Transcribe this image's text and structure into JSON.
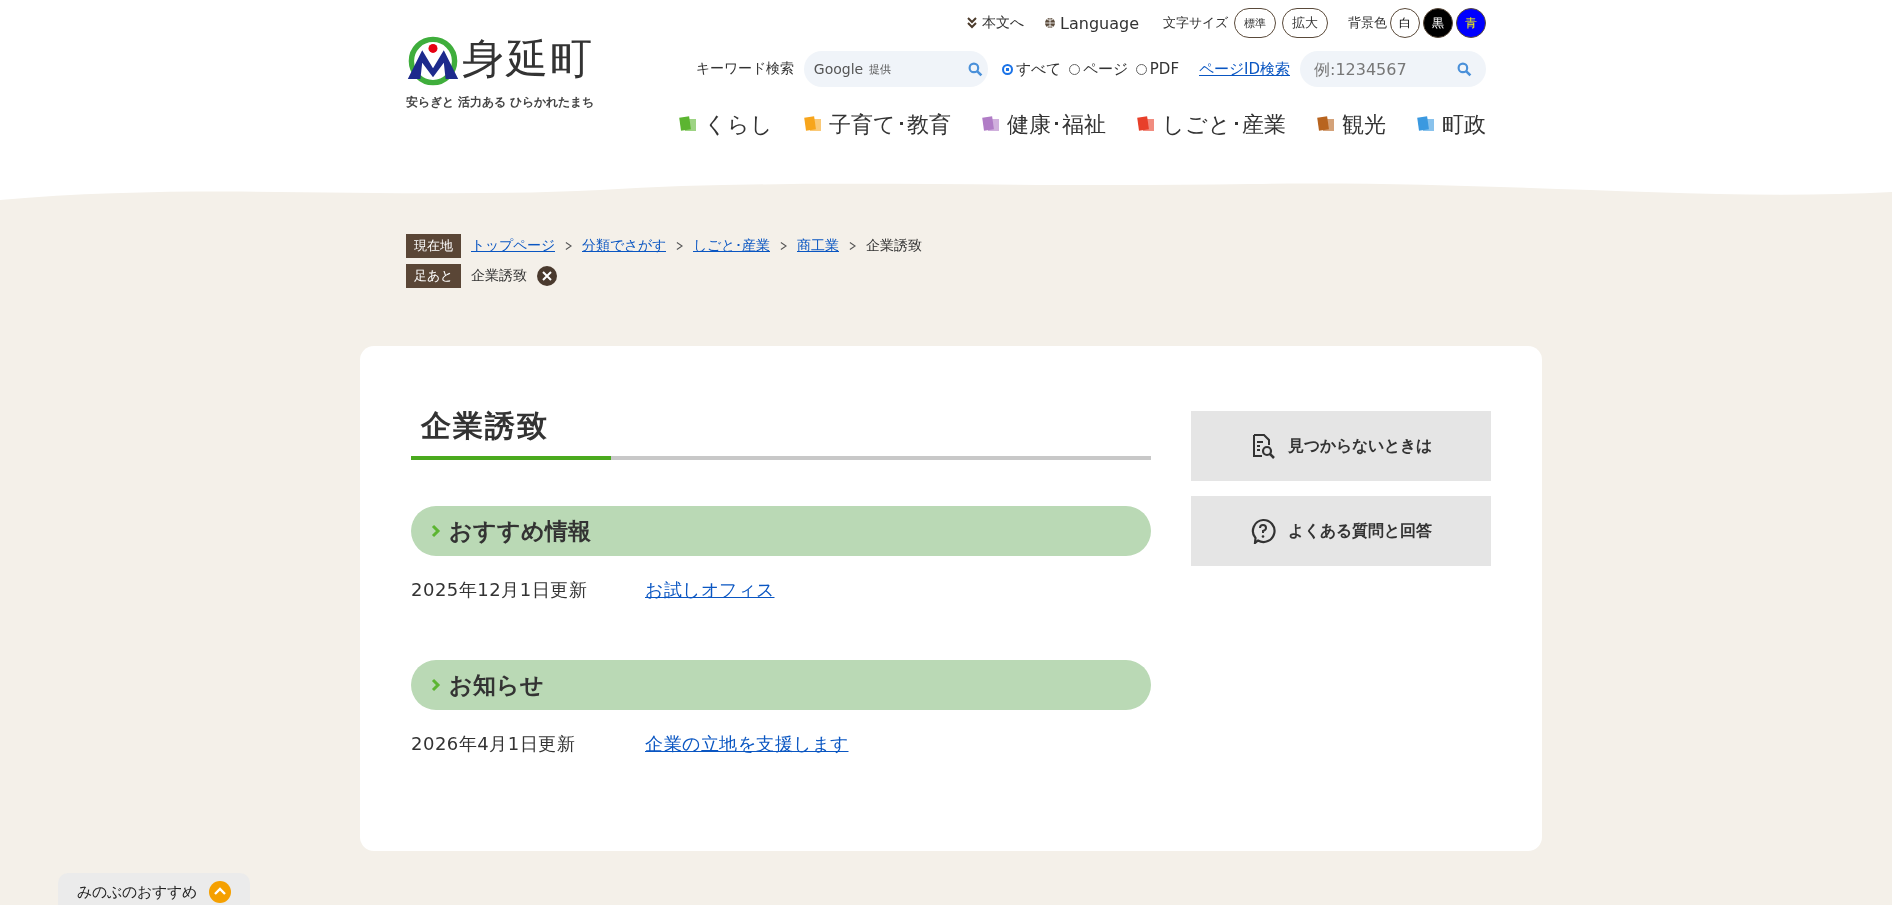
{
  "header": {
    "logo": {
      "name": "身延町",
      "tagline": "安らぎと 活力ある ひらかれたまち"
    },
    "utility": {
      "skip_link": "本文へ",
      "language": "Language",
      "font_size_label": "文字サイズ",
      "font_sizes": [
        "標準",
        "拡大"
      ],
      "bg_label": "背景色",
      "bg_colors": [
        {
          "label": "白",
          "color": "#ffffff"
        },
        {
          "label": "黒",
          "color": "#000000"
        },
        {
          "label": "青",
          "color": "#0000ff"
        }
      ]
    },
    "search": {
      "label": "キーワード検索",
      "google": "Google",
      "provided": "提供",
      "scopes": [
        {
          "label": "すべて",
          "selected": true
        },
        {
          "label": "ページ",
          "selected": false
        },
        {
          "label": "PDF",
          "selected": false
        }
      ],
      "page_id_link": "ページID検索",
      "page_id_placeholder": "例:1234567"
    },
    "nav": [
      {
        "label": "くらし",
        "color": "#5cb531"
      },
      {
        "label": "子育て･教育",
        "color": "#f7a51c"
      },
      {
        "label": "健康･福祉",
        "color": "#b07cc6"
      },
      {
        "label": "しごと･産業",
        "color": "#e8402a"
      },
      {
        "label": "観光",
        "color": "#b8641f"
      },
      {
        "label": "町政",
        "color": "#3b99e0"
      }
    ]
  },
  "breadcrumb": {
    "label": "現在地",
    "links": [
      "トップページ",
      "分類でさがす",
      "しごと･産業",
      "商工業"
    ],
    "current": "企業誘致"
  },
  "footprints": {
    "label": "足あと",
    "items": [
      "企業誘致"
    ]
  },
  "main": {
    "title": "企業誘致",
    "sections": [
      {
        "heading": "おすすめ情報",
        "items": [
          {
            "date": "2025年12月1日更新",
            "link": "お試しオフィス"
          }
        ]
      },
      {
        "heading": "お知らせ",
        "items": [
          {
            "date": "2026年4月1日更新",
            "link": "企業の立地を支援します"
          }
        ]
      }
    ]
  },
  "sidebar": [
    {
      "label": "見つからないときは",
      "kind": "search"
    },
    {
      "label": "よくある質問と回答",
      "kind": "faq"
    }
  ],
  "bottom_tab": {
    "label": "みのぶのおすすめ"
  }
}
